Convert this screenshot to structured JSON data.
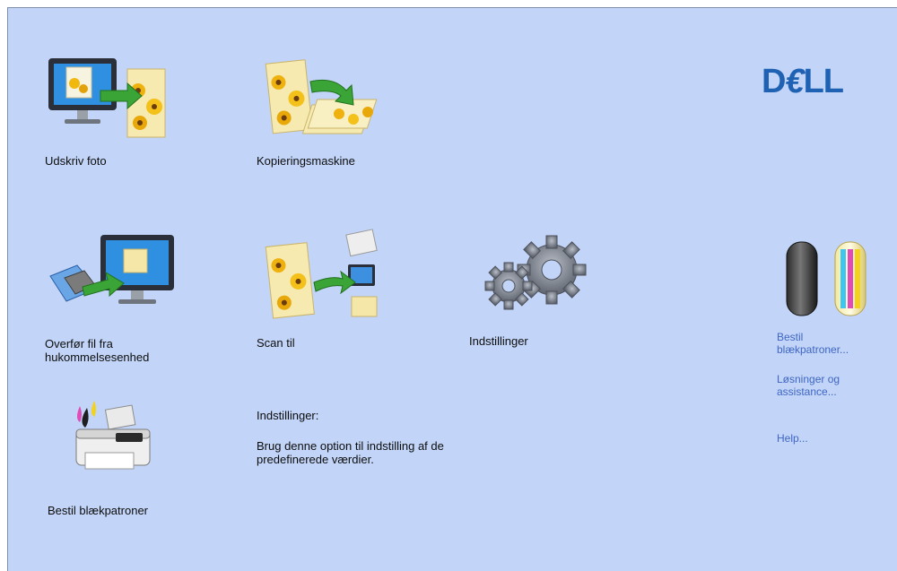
{
  "tiles": {
    "print_photo": "Udskriv foto",
    "copier": "Kopieringsmaskine",
    "transfer_line1": "Overfør fil fra",
    "transfer_line2": "hukommelsesenhed",
    "scan_to": "Scan til",
    "settings": "Indstillinger",
    "order_ink": "Bestil blækpatroner"
  },
  "description": {
    "title": "Indstillinger:",
    "body": "Brug denne option til indstilling af de predefinerede værdier."
  },
  "side_links": {
    "order_line1": "Bestil",
    "order_line2": "blækpatroner...",
    "solutions_line1": "Løsninger og",
    "solutions_line2": "assistance...",
    "help": "Help..."
  },
  "brand": "DELL",
  "colors": {
    "panel_bg": "#c2d5f8",
    "link": "#3f66c2",
    "brand": "#1f62b3"
  }
}
